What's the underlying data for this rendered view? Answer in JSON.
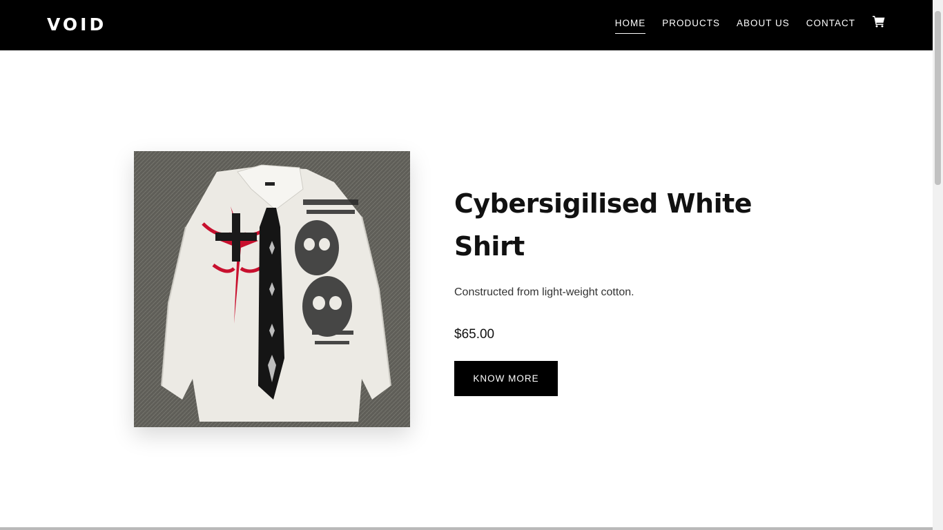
{
  "header": {
    "logo": "VOID",
    "nav": [
      {
        "label": "HOME",
        "active": true
      },
      {
        "label": "PRODUCTS",
        "active": false
      },
      {
        "label": "ABOUT US",
        "active": false
      },
      {
        "label": "CONTACT",
        "active": false
      }
    ],
    "cart_icon": "shopping-cart-icon"
  },
  "product": {
    "title": "Cybersigilised White Shirt",
    "description": "Constructed from light-weight cotton.",
    "price": "$65.00",
    "button_label": "KNOW MORE",
    "image_icon": "shirt-image"
  },
  "colors": {
    "header_bg": "#000000",
    "button_bg": "#000000",
    "accent_red": "#c8102e"
  }
}
